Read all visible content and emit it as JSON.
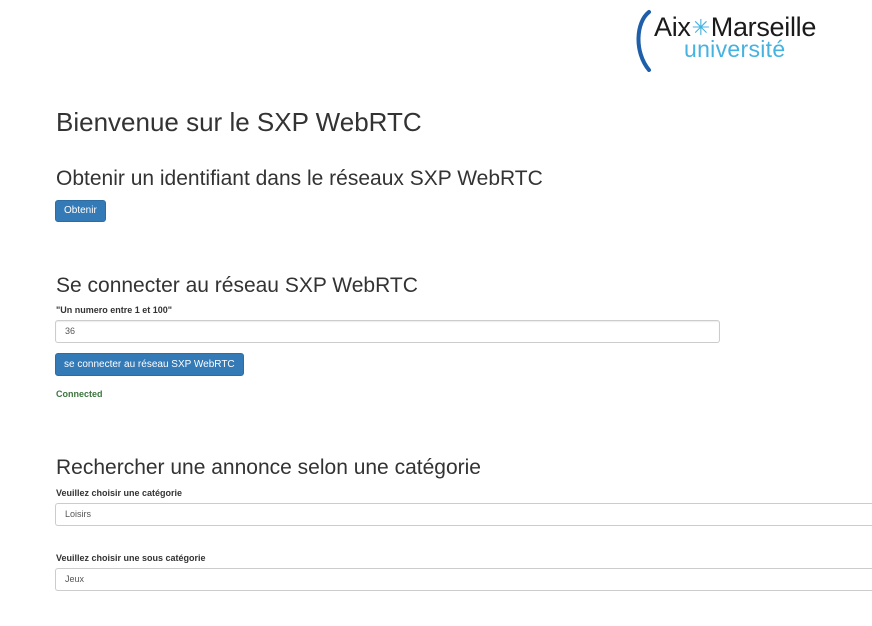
{
  "logo": {
    "line1_left": "Aix",
    "line1_right": "Marseille",
    "line2": "université",
    "star": "✳",
    "colors": {
      "dark": "#1a1a1a",
      "accent": "#45b2e0",
      "arc": "#1f5ea8"
    }
  },
  "page": {
    "title": "Bienvenue sur le SXP WebRTC"
  },
  "identifier_section": {
    "title": "Obtenir un identifiant dans le réseaux SXP WebRTC",
    "button_label": "Obtenir"
  },
  "connect_section": {
    "title": "Se connecter au réseau SXP WebRTC",
    "field_label": "\"Un numero entre 1 et 100\"",
    "field_value": "36",
    "button_label": "se connecter au réseau SXP WebRTC",
    "status": "Connected"
  },
  "search_section": {
    "title": "Rechercher une annonce selon une catégorie",
    "category_label": "Veuillez choisir une catégorie",
    "category_value": "Loisirs",
    "subcategory_label": "Veuillez choisir une sous catégorie",
    "subcategory_value": "Jeux"
  },
  "colors": {
    "primary_button": "#337ab7",
    "success_text": "#3c763d",
    "text": "#333333"
  }
}
